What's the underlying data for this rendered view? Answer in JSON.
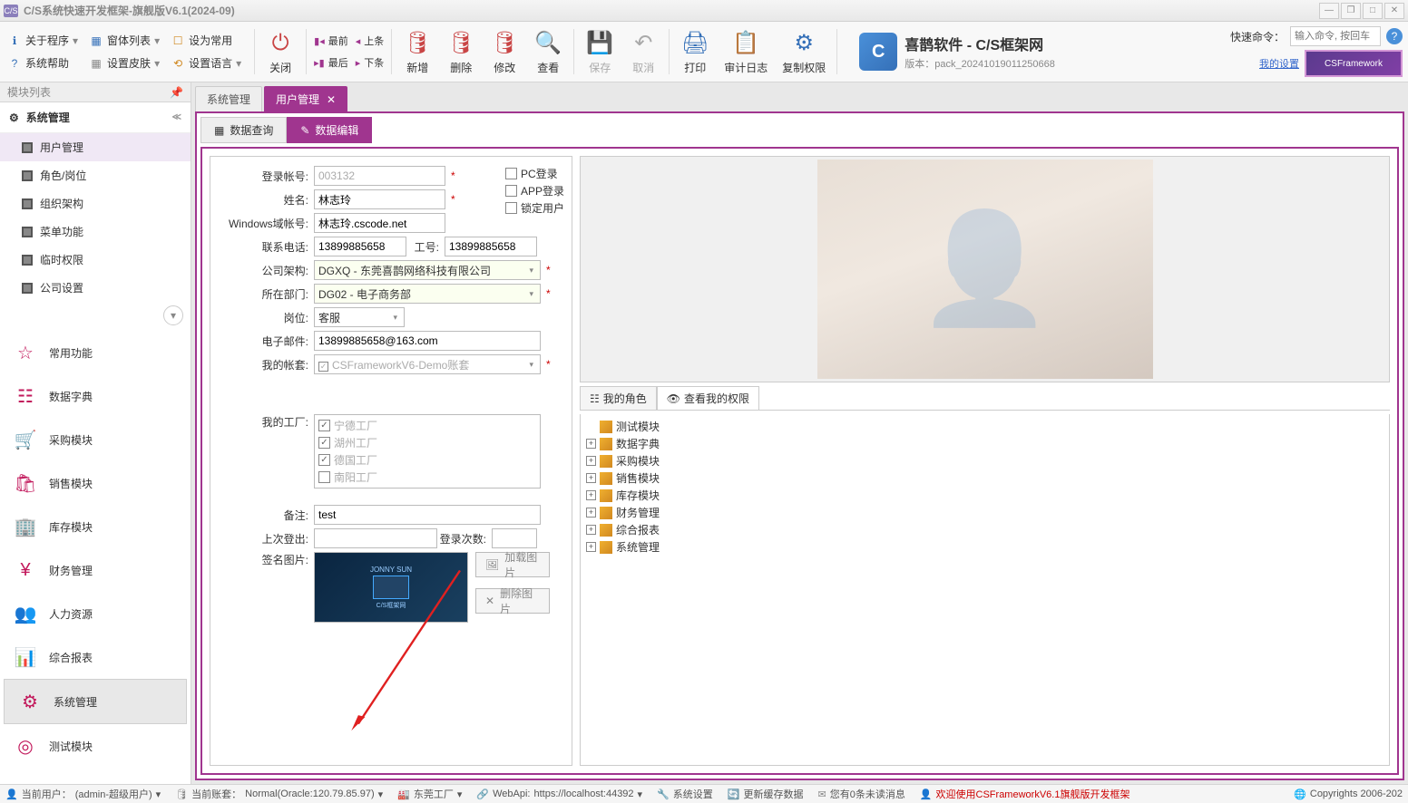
{
  "title_bar": {
    "app_icon": "C/S",
    "title": "C/S系统快速开发框架-旗舰版V6.1(2024-09)"
  },
  "toolbar": {
    "about": "关于程序",
    "windows": "窗体列表",
    "set_common": "设为常用",
    "help": "系统帮助",
    "skin": "设置皮肤",
    "lang": "设置语言",
    "close": "关闭",
    "first": "最前",
    "prev": "上条",
    "last": "最后",
    "next": "下条",
    "add": "新增",
    "delete": "删除",
    "modify": "修改",
    "view": "查看",
    "save": "保存",
    "cancel": "取消",
    "print": "打印",
    "audit": "审计日志",
    "copyperm": "复制权限",
    "brand_title": "喜鹊软件 - C/S框架网",
    "brand_sub": "版本：pack_20241019011250668",
    "brand_caption": "C/S框架网",
    "quick_label": "快速命令：",
    "quick_placeholder": "输入命令, 按回车",
    "my_settings": "我的设置",
    "csf": "CSFramework"
  },
  "sidebar": {
    "header": "模块列表",
    "sys_mgmt": "系统管理",
    "items": [
      "用户管理",
      "角色/岗位",
      "组织架构",
      "菜单功能",
      "临时权限",
      "公司设置"
    ],
    "big_items": [
      "常用功能",
      "数据字典",
      "采购模块",
      "销售模块",
      "库存模块",
      "财务管理",
      "人力资源",
      "综合报表",
      "系统管理",
      "测试模块"
    ]
  },
  "tabs": {
    "sys": "系统管理",
    "user": "用户管理"
  },
  "sub_tabs": {
    "query": "数据查询",
    "edit": "数据编辑"
  },
  "form": {
    "login_id_label": "登录帐号:",
    "login_id": "003132",
    "name_label": "姓名:",
    "name": "林志玲",
    "domain_label": "Windows域帐号:",
    "domain": "林志玲.cscode.net",
    "phone_label": "联系电话:",
    "phone": "13899885658",
    "workno_label": "工号:",
    "workno": "13899885658",
    "org_label": "公司架构:",
    "org": "DGXQ - 东莞喜鹊网络科技有限公司",
    "dept_label": "所在部门:",
    "dept": "DG02 - 电子商务部",
    "pos_label": "岗位:",
    "pos": "客服",
    "email_label": "电子邮件:",
    "email": "13899885658@163.com",
    "myacct_label": "我的帐套:",
    "myacct": "CSFrameworkV6-Demo账套",
    "myfactory_label": "我的工厂:",
    "factories": [
      "宁德工厂",
      "湖州工厂",
      "德国工厂",
      "南阳工厂"
    ],
    "remark_label": "备注:",
    "remark": "test",
    "lastlogin_label": "上次登出:",
    "lastlogin": "",
    "logincount_label": "登录次数:",
    "logincount": "",
    "sig_label": "签名图片:",
    "pc_login": "PC登录",
    "app_login": "APP登录",
    "lock_user": "锁定用户",
    "btn_load": "加载图片",
    "btn_del": "删除图片",
    "sig_line1": "JONNY SUN",
    "sig_line2": "C/S框架网"
  },
  "perm_tabs": {
    "roles": "我的角色",
    "view_perm": "查看我的权限"
  },
  "perm_tree": [
    "测试模块",
    "数据字典",
    "采购模块",
    "销售模块",
    "库存模块",
    "财务管理",
    "综合报表",
    "系统管理"
  ],
  "status": {
    "user_label": "当前用户：",
    "user": "(admin-超级用户)",
    "acct_label": "当前账套：",
    "acct": "Normal(Oracle:120.79.85.97)",
    "factory": "东莞工厂",
    "webapi_label": "WebApi:",
    "webapi": "https://localhost:44392",
    "sys_settings": "系统设置",
    "refresh": "更新缓存数据",
    "unread": "您有0条未读消息",
    "welcome": "欢迎使用CSFrameworkV6.1旗舰版开发框架",
    "copyright": "Copyrights 2006-202"
  }
}
